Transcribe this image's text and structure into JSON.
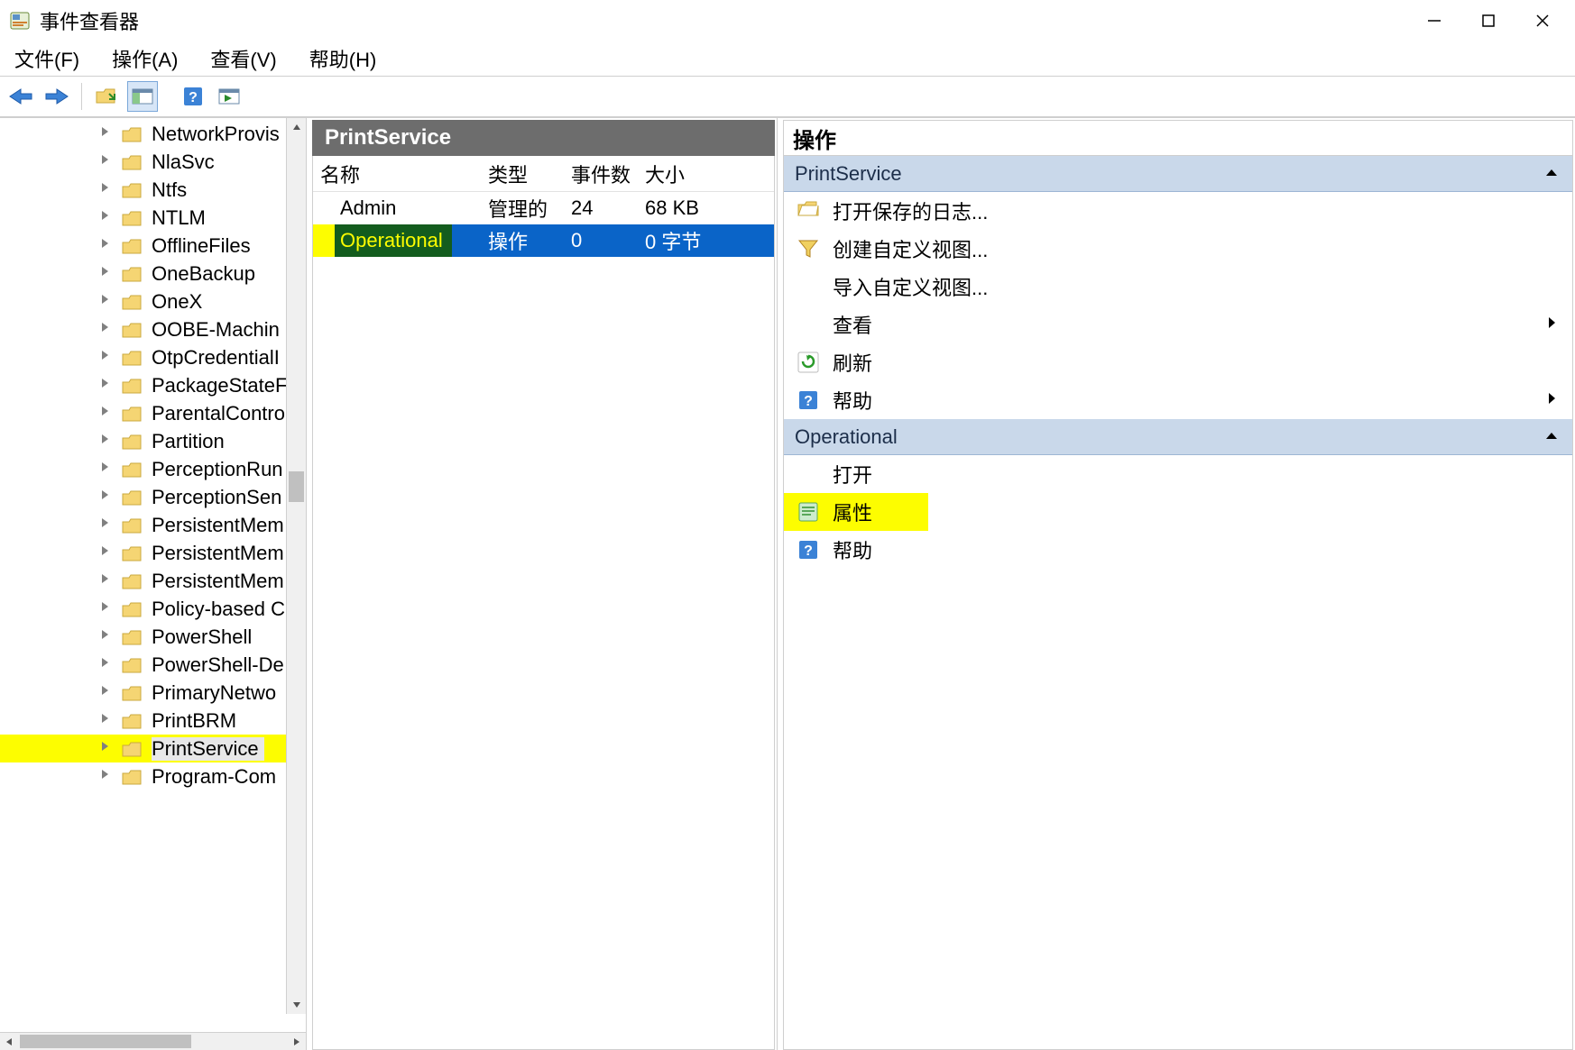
{
  "window": {
    "title": "事件查看器"
  },
  "menu": {
    "file": "文件(F)",
    "action": "操作(A)",
    "view": "查看(V)",
    "help": "帮助(H)"
  },
  "tree": {
    "items": [
      {
        "label": "NetworkProvis"
      },
      {
        "label": "NlaSvc"
      },
      {
        "label": "Ntfs"
      },
      {
        "label": "NTLM"
      },
      {
        "label": "OfflineFiles"
      },
      {
        "label": "OneBackup"
      },
      {
        "label": "OneX"
      },
      {
        "label": "OOBE-Machin"
      },
      {
        "label": "OtpCredentialI"
      },
      {
        "label": "PackageStateF"
      },
      {
        "label": "ParentalContro"
      },
      {
        "label": "Partition"
      },
      {
        "label": "PerceptionRun"
      },
      {
        "label": "PerceptionSen"
      },
      {
        "label": "PersistentMem"
      },
      {
        "label": "PersistentMem"
      },
      {
        "label": "PersistentMem"
      },
      {
        "label": "Policy-based C"
      },
      {
        "label": "PowerShell"
      },
      {
        "label": "PowerShell-De"
      },
      {
        "label": "PrimaryNetwo"
      },
      {
        "label": "PrintBRM"
      },
      {
        "label": "PrintService"
      },
      {
        "label": "Program-Com"
      }
    ],
    "highlight_index": 22
  },
  "center": {
    "title": "PrintService",
    "columns": {
      "name": "名称",
      "type": "类型",
      "count": "事件数",
      "size": "大小"
    },
    "rows": [
      {
        "name": "Admin",
        "type": "管理的",
        "count": "24",
        "size": "68 KB",
        "selected": false,
        "highlight": false
      },
      {
        "name": "Operational",
        "type": "操作",
        "count": "0",
        "size": "0 字节",
        "selected": true,
        "highlight": true
      }
    ]
  },
  "actions": {
    "title": "操作",
    "group1": {
      "header": "PrintService",
      "open_saved_log": "打开保存的日志...",
      "create_custom_view": "创建自定义视图...",
      "import_custom_view": "导入自定义视图...",
      "view": "查看",
      "refresh": "刷新",
      "help": "帮助"
    },
    "group2": {
      "header": "Operational",
      "open": "打开",
      "properties": "属性",
      "help": "帮助"
    }
  }
}
